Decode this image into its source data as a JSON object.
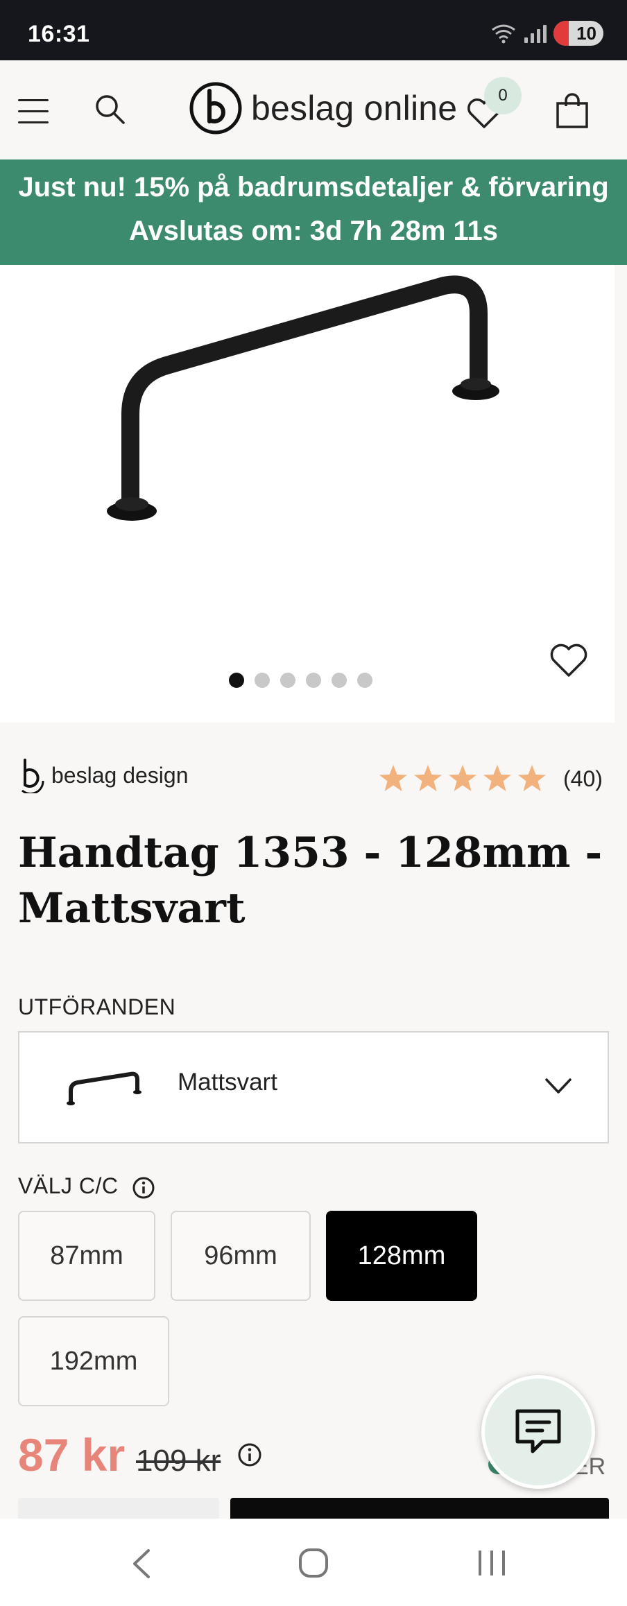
{
  "status_bar": {
    "time": "16:31",
    "battery": "10"
  },
  "header": {
    "logo_text": "beslag online",
    "wishlist_count": "0"
  },
  "promo": {
    "line1": "Just nu! 15% på badrumsdetaljer & förvaring",
    "line2": "Avslutas om: 3d 7h 28m 11s"
  },
  "gallery": {
    "image_count": 6,
    "active_index": 0
  },
  "product": {
    "brand": "beslag design",
    "rating": {
      "stars": 5,
      "count": "(40)"
    },
    "title": "Handtag 1353 - 128mm - Mattsvart",
    "variants_label": "UTFÖRANDEN",
    "selected_variant": "Mattsvart",
    "cc_label": "VÄLJ C/C",
    "sizes": [
      "87mm",
      "96mm",
      "128mm",
      "192mm"
    ],
    "selected_size": "128mm",
    "price": "87 kr",
    "old_price": "109 kr",
    "stock_text": "ER"
  },
  "colors": {
    "promo_bg": "#3c8b6e",
    "price": "#e8857b",
    "star": "#f2b27d",
    "status_bar_bg": "#16161d"
  }
}
